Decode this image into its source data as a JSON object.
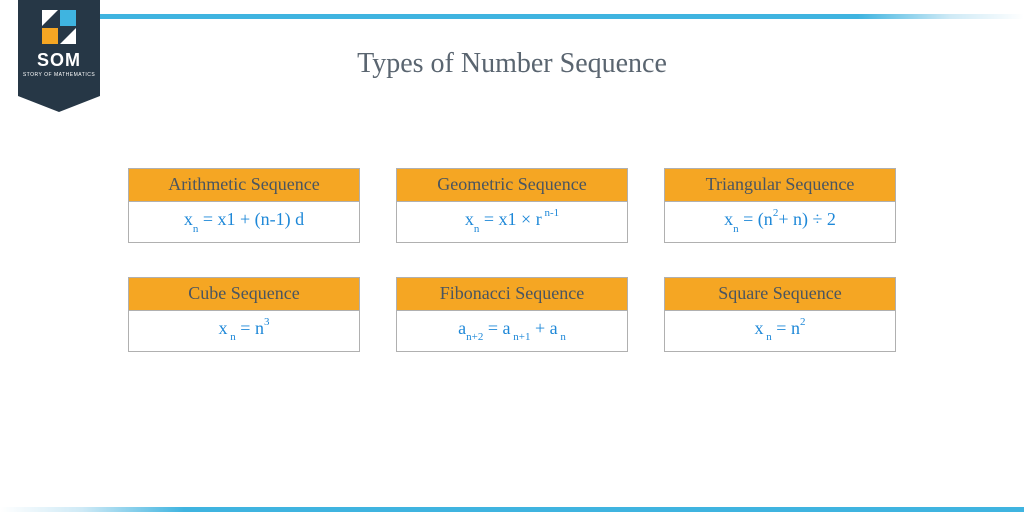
{
  "logo": {
    "text": "SOM",
    "subtitle": "STORY OF MATHEMATICS"
  },
  "title": "Types of Number Sequence",
  "cards": [
    {
      "name": "Arithmetic Sequence",
      "formula_parts": {
        "a": "x",
        "b": "n",
        "c": " = x1 + (n-1) d"
      }
    },
    {
      "name": "Geometric Sequence",
      "formula_parts": {
        "a": "x",
        "b": "n",
        "c": " = x1 × r",
        "d": " n-1"
      }
    },
    {
      "name": "Triangular Sequence",
      "formula_parts": {
        "a": "x",
        "b": "n",
        "c": " = (n",
        "d": "2",
        "e": "+ n) ÷  2"
      }
    },
    {
      "name": "Cube Sequence",
      "formula_parts": {
        "a": "x",
        "b": " n",
        "c": " = n",
        "d": "3"
      }
    },
    {
      "name": "Fibonacci Sequence",
      "formula_parts": {
        "a": "a",
        "b": "n+2",
        "c": "  = a",
        "d": " n+1",
        "e": " + a",
        "f": " n"
      }
    },
    {
      "name": "Square Sequence",
      "formula_parts": {
        "a": "x",
        "b": " n",
        "c": " = n",
        "d": "2"
      }
    }
  ]
}
